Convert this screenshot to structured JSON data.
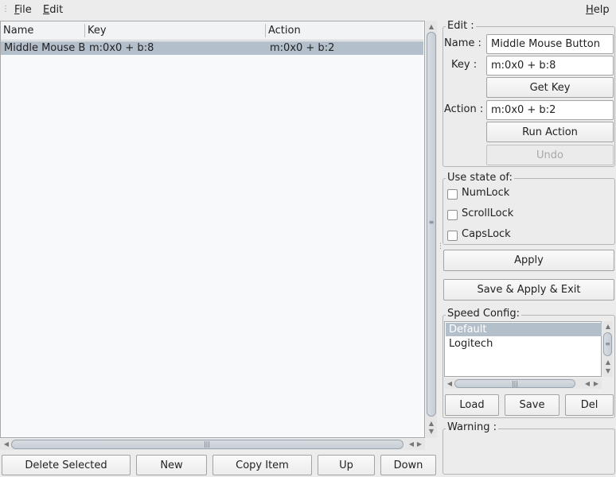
{
  "menubar": {
    "file_mnemonic": "F",
    "file_rest": "ile",
    "edit_mnemonic": "E",
    "edit_rest": "dit",
    "help_mnemonic": "H",
    "help_rest": "elp"
  },
  "table": {
    "columns": [
      "Name",
      "Key",
      "Action"
    ],
    "rows": [
      {
        "name": "Middle Mouse B",
        "key": "m:0x0 + b:8",
        "action": "m:0x0 + b:2",
        "selected": true
      }
    ]
  },
  "bottom_buttons": {
    "delete": "Delete Selected",
    "new": "New",
    "copy": "Copy Item",
    "up": "Up",
    "down": "Down"
  },
  "edit_group": {
    "title": "Edit :",
    "name_label": "Name :",
    "name_value": "Middle Mouse Button",
    "key_label": "Key :",
    "key_value": "m:0x0 + b:8",
    "get_key": "Get Key",
    "action_label": "Action :",
    "action_value": "m:0x0 + b:2",
    "run_action": "Run Action",
    "undo": "Undo"
  },
  "state_group": {
    "title": "Use state of:",
    "checkboxes": [
      {
        "label": "NumLock",
        "checked": false
      },
      {
        "label": "ScrollLock",
        "checked": false
      },
      {
        "label": "CapsLock",
        "checked": false
      }
    ]
  },
  "actions": {
    "apply": "Apply",
    "save_apply_exit": "Save & Apply & Exit"
  },
  "speed_group": {
    "title": "Speed Config:",
    "items": [
      {
        "label": "Default",
        "selected": true
      },
      {
        "label": "Logitech",
        "selected": false
      }
    ],
    "load": "Load",
    "save": "Save",
    "del": "Del"
  },
  "warning_group": {
    "title": "Warning :",
    "text": ""
  },
  "colors": {
    "selection": "#b4bfcc",
    "window_bg": "#ececec",
    "list_bg": "#f7f9fb"
  }
}
